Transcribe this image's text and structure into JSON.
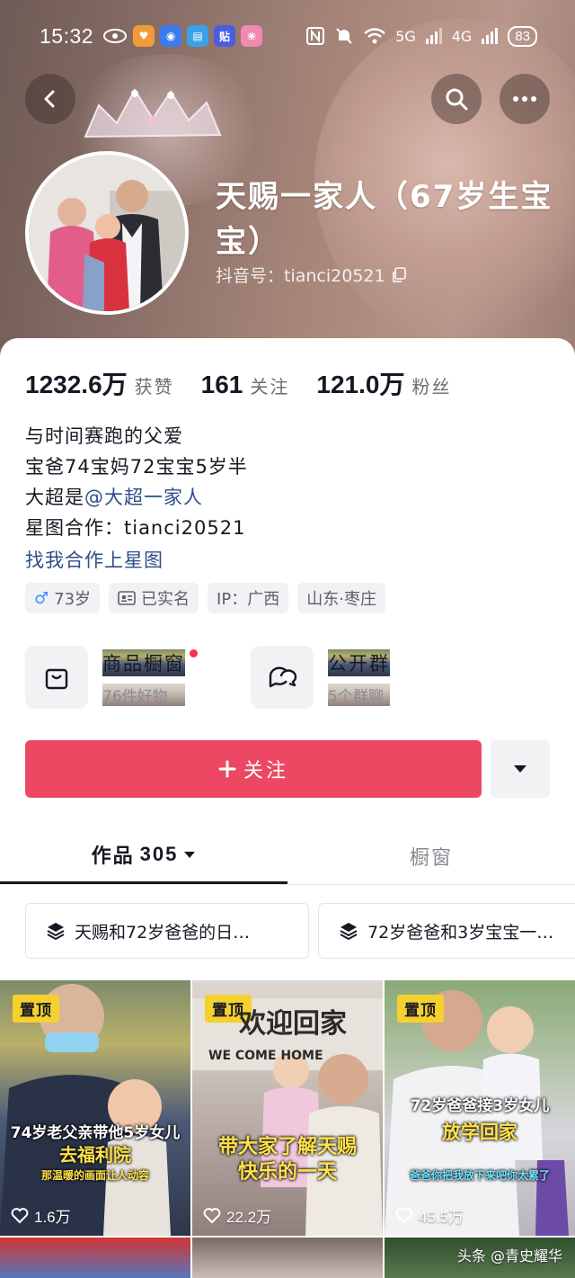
{
  "status_bar": {
    "time": "15:32",
    "battery": "83",
    "network_1": "5G",
    "network_2": "4G"
  },
  "profile": {
    "name": "天赐一家人（67岁生宝宝）",
    "douyin_id": "抖音号：tianci20521"
  },
  "stats": [
    {
      "num": "1232.6万",
      "label": "获赞"
    },
    {
      "num": "161",
      "label": "关注"
    },
    {
      "num": "121.0万",
      "label": "粉丝"
    }
  ],
  "bio": {
    "line1": "与时间赛跑的父爱",
    "line2": "宝爸74宝妈72宝宝5岁半",
    "line3_prefix": "大超是",
    "line3_mention": "@大超一家人",
    "line4": "星图合作：tianci20521",
    "link": "找我合作上星图"
  },
  "tags": {
    "age": "73岁",
    "verified": "已实名",
    "ip": "IP：广西",
    "location": "山东·枣庄"
  },
  "features": {
    "shop_title": "商品橱窗",
    "shop_sub": "76件好物",
    "group_title": "公开群",
    "group_sub": "5个群聊"
  },
  "actions": {
    "follow": "关注"
  },
  "tabs": {
    "works_label": "作品",
    "works_count": "305",
    "window_label": "橱窗"
  },
  "collections": [
    "天赐和72岁爸爸的日…",
    "72岁爸爸和3岁宝宝一…"
  ],
  "videos": [
    {
      "pin": "置顶",
      "caption_main": "74岁老父亲带他5岁女儿",
      "caption_sub": "去福利院",
      "caption_small": "那温暖的画面让人动容",
      "likes": "1.6万"
    },
    {
      "pin": "置顶",
      "sign": "欢迎回家",
      "sign_en": "WE COME HOME",
      "caption_main": "带大家了解天赐快乐的一天",
      "likes": "22.2万"
    },
    {
      "pin": "置顶",
      "caption_main": "72岁爸爸接3岁女儿",
      "caption_sub": "放学回家",
      "caption_small": "爸爸你把我放下来吧你太累了",
      "likes": "45.5万"
    }
  ],
  "watermark": "头条 @青史耀华",
  "colors": {
    "accent": "#ec4863",
    "pin": "#f6d12d",
    "mention": "#2f4d8a"
  }
}
